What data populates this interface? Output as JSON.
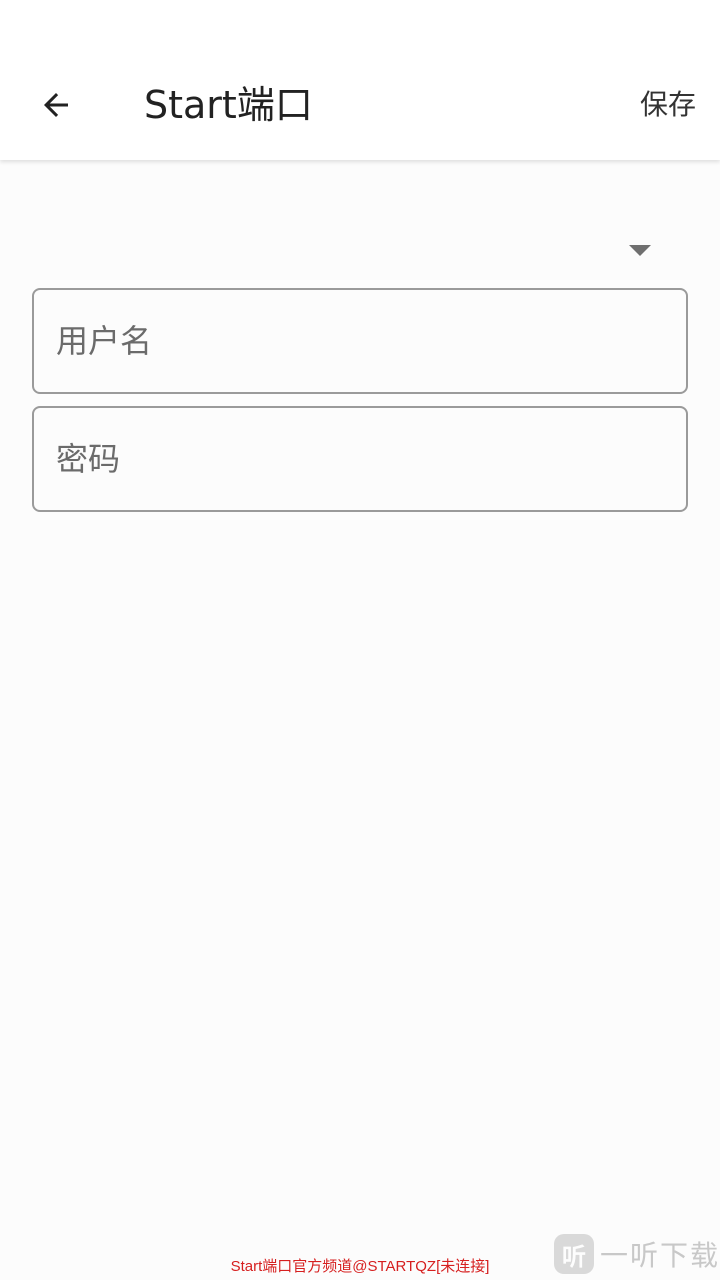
{
  "appbar": {
    "title": "Start端口",
    "save_label": "保存",
    "back_icon": "arrow-left-icon"
  },
  "form": {
    "dropdown": {
      "value": "",
      "icon": "caret-down-icon"
    },
    "username": {
      "placeholder": "用户名",
      "value": ""
    },
    "password": {
      "placeholder": "密码",
      "value": ""
    }
  },
  "footer": {
    "status_text": "Start端口官方频道@STARTQZ[未连接]",
    "status_color": "#d61f1f"
  },
  "watermark": {
    "logo_glyph": "听",
    "text": "一听下载"
  }
}
